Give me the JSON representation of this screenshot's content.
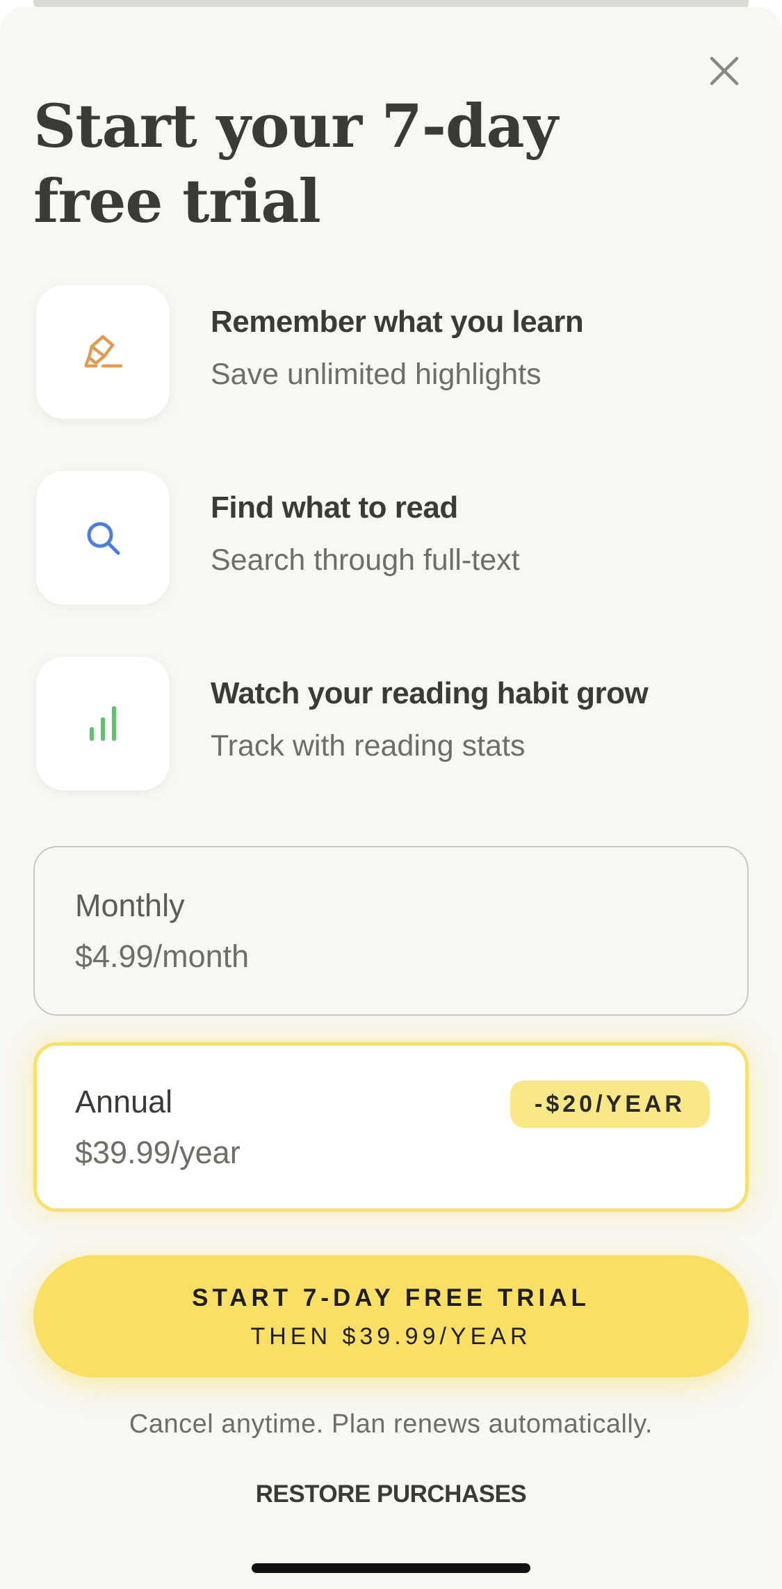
{
  "header": {
    "title_line1": "Start your 7-day",
    "title_line2": "free trial",
    "close_icon": "close-icon"
  },
  "features": [
    {
      "icon": "highlighter-icon",
      "icon_color": "#e39a52",
      "title": "Remember what you learn",
      "subtitle": "Save unlimited highlights"
    },
    {
      "icon": "search-icon",
      "icon_color": "#4a7de0",
      "title": "Find what to read",
      "subtitle": "Search through full-text"
    },
    {
      "icon": "bar-chart-icon",
      "icon_color": "#5ac467",
      "title": "Watch your reading habit grow",
      "subtitle": "Track with reading stats"
    }
  ],
  "plans": {
    "monthly": {
      "name": "Monthly",
      "price": "$4.99/month",
      "selected": false
    },
    "annual": {
      "name": "Annual",
      "price": "$39.99/year",
      "badge": "-$20/YEAR",
      "selected": true
    }
  },
  "cta": {
    "line1": "START 7-DAY FREE TRIAL",
    "line2": "THEN $39.99/YEAR"
  },
  "fine_print": "Cancel anytime. Plan renews automatically.",
  "restore_label": "RESTORE PURCHASES",
  "colors": {
    "accent_yellow": "#f9e064",
    "background": "#f8f7f2",
    "text_primary": "#3b3a37",
    "text_secondary": "#6f6d68"
  }
}
